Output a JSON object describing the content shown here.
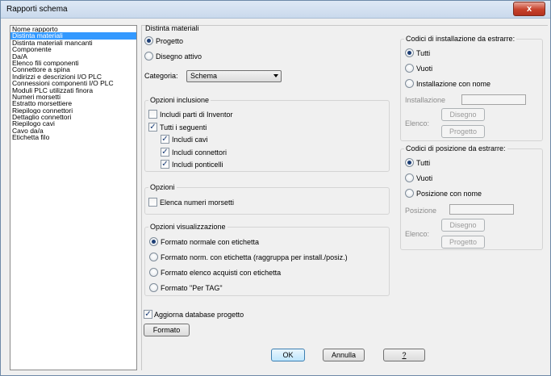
{
  "window": {
    "title": "Rapporti schema",
    "close_glyph": "x"
  },
  "report_list": {
    "items": [
      {
        "label": "Nome rapporto",
        "selected": false
      },
      {
        "label": "Distinta materiali",
        "selected": true
      },
      {
        "label": "Distinta materiali mancanti",
        "selected": false
      },
      {
        "label": "Componente",
        "selected": false
      },
      {
        "label": "Da/A",
        "selected": false
      },
      {
        "label": "Elenco fili componenti",
        "selected": false
      },
      {
        "label": "Connettore a spina",
        "selected": false
      },
      {
        "label": "Indirizzi e descrizioni I/O PLC",
        "selected": false
      },
      {
        "label": "Connessioni componenti I/O PLC",
        "selected": false
      },
      {
        "label": "Moduli PLC utilizzati finora",
        "selected": false
      },
      {
        "label": "Numeri morsetti",
        "selected": false
      },
      {
        "label": "Estratto morsettiere",
        "selected": false
      },
      {
        "label": "Riepilogo connettori",
        "selected": false
      },
      {
        "label": "Dettaglio connettori",
        "selected": false
      },
      {
        "label": "Riepilogo cavi",
        "selected": false
      },
      {
        "label": "Cavo da/a",
        "selected": false
      },
      {
        "label": "Etichetta filo",
        "selected": false
      }
    ]
  },
  "panel": {
    "title": "Distinta materiali",
    "source": {
      "progetto": "Progetto",
      "disegno": "Disegno attivo",
      "selected": "progetto"
    },
    "categoria": {
      "label": "Categoria:",
      "value": "Schema"
    },
    "inclusione": {
      "legend": "Opzioni inclusione",
      "includi_inventor": "Includi parti di Inventor",
      "tutti_seguenti": "Tutti i seguenti",
      "includi_cavi": "Includi cavi",
      "includi_connettori": "Includi connettori",
      "includi_ponticelli": "Includi ponticelli",
      "check_glyph": "✓"
    },
    "opzioni": {
      "legend": "Opzioni",
      "elenca_morsetti": "Elenca numeri morsetti"
    },
    "visualizzazione": {
      "legend": "Opzioni visualizzazione",
      "opt1": "Formato normale con etichetta",
      "opt2": "Formato norm. con etichetta (raggruppa per install./posiz.)",
      "opt3": "Formato elenco acquisti con etichetta",
      "opt4": "Formato \"Per TAG\"",
      "selected": 1
    },
    "aggiorna": "Aggiorna database progetto",
    "formato_button": "Formato",
    "installazione": {
      "legend": "Codici di installazione da estrarre:",
      "tutti": "Tutti",
      "vuoti": "Vuoti",
      "con_nome": "Installazione con nome",
      "field_label": "Installazione",
      "disegno_button": "Disegno",
      "elenco_label": "Elenco:",
      "progetto_button": "Progetto"
    },
    "posizione": {
      "legend": "Codici di posizione da estrarre:",
      "tutti": "Tutti",
      "vuoti": "Vuoti",
      "con_nome": "Posizione con nome",
      "field_label": "Posizione",
      "disegno_button": "Disegno",
      "elenco_label": "Elenco:",
      "progetto_button": "Progetto"
    }
  },
  "footer": {
    "ok": "OK",
    "annulla": "Annulla",
    "help": "?"
  }
}
